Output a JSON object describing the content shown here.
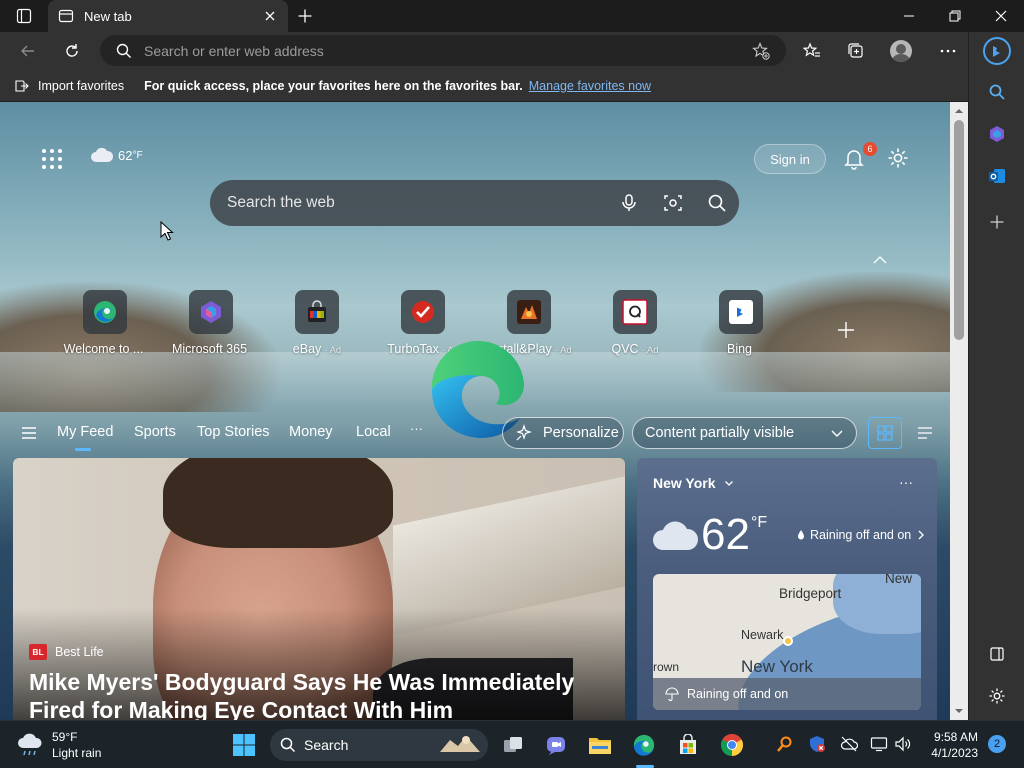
{
  "window": {
    "tab_title": "New tab"
  },
  "toolbar": {
    "address_placeholder": "Search or enter web address"
  },
  "favorites_bar": {
    "import_label": "Import favorites",
    "message": "For quick access, place your favorites here on the favorites bar.",
    "manage_link": "Manage favorites now"
  },
  "newtab": {
    "weather_temp": "62",
    "weather_unit": "°F",
    "sign_in": "Sign in",
    "notification_count": "6",
    "search_placeholder": "Search the web",
    "quick_links": [
      {
        "label": "Welcome to ...",
        "ad": "",
        "icon": "edge-icon"
      },
      {
        "label": "Microsoft 365",
        "ad": "",
        "icon": "microsoft365-icon"
      },
      {
        "label": "eBay",
        "ad": "· Ad",
        "icon": "ebay-icon"
      },
      {
        "label": "TurboTax",
        "ad": "· Ad",
        "icon": "turbotax-icon"
      },
      {
        "label": "Install&Play",
        "ad": "· Ad",
        "icon": "game-icon"
      },
      {
        "label": "QVC",
        "ad": "· Ad",
        "icon": "qvc-icon"
      },
      {
        "label": "Bing",
        "ad": "",
        "icon": "bing-icon"
      }
    ]
  },
  "feed_nav": {
    "items": [
      "My Feed",
      "Sports",
      "Top Stories",
      "Money",
      "Local"
    ],
    "more": "···",
    "personalize": "Personalize",
    "content_visibility": "Content partially visible"
  },
  "hero": {
    "source": "Best Life",
    "source_logo": "BL",
    "headline": "Mike Myers' Bodyguard Says He Was Immediately Fired for Making Eye Contact With Him"
  },
  "weather_card": {
    "city": "New York",
    "temp": "62",
    "unit": "°F",
    "condition": "Raining off and on",
    "map_condition": "Raining off and on",
    "map_labels": [
      "Bridgeport",
      "Newark",
      "New York",
      "New",
      "rown"
    ]
  },
  "taskbar": {
    "weather_temp": "59°F",
    "weather_desc": "Light rain",
    "search_label": "Search",
    "time": "9:58 AM",
    "date": "4/1/2023",
    "notification_count": "2"
  },
  "colors": {
    "accent": "#5cb8ff",
    "link": "#7fb7f0",
    "badge": "#e74b2f"
  }
}
